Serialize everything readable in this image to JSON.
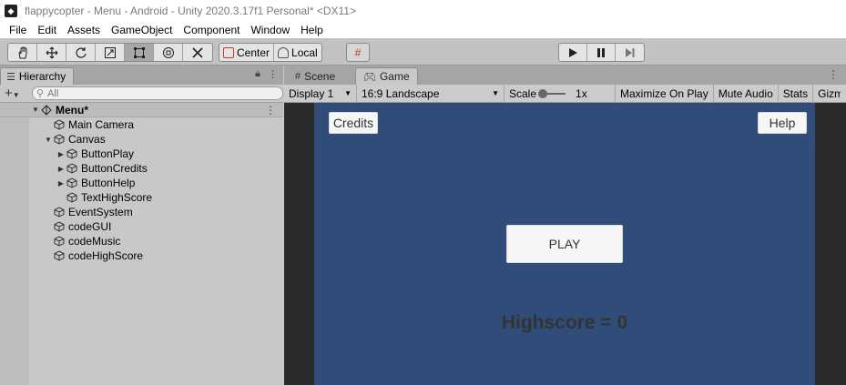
{
  "window": {
    "title": "flappycopter - Menu - Android - Unity 2020.3.17f1 Personal* <DX11>"
  },
  "menubar": [
    "File",
    "Edit",
    "Assets",
    "GameObject",
    "Component",
    "Window",
    "Help"
  ],
  "toolbar": {
    "tools": [
      "hand-tool",
      "move-tool",
      "rotate-tool",
      "scale-tool",
      "rect-tool",
      "transform-tool",
      "custom-tool"
    ],
    "active_tool": "rect-tool",
    "pivot_mode": "Center",
    "pivot_rotation": "Local"
  },
  "hierarchy": {
    "tab_label": "Hierarchy",
    "search_placeholder": "All",
    "scene_name": "Menu*",
    "items": [
      {
        "label": "Main Camera",
        "depth": 1,
        "arrow": ""
      },
      {
        "label": "Canvas",
        "depth": 1,
        "arrow": "expanded"
      },
      {
        "label": "ButtonPlay",
        "depth": 2,
        "arrow": "collapsed"
      },
      {
        "label": "ButtonCredits",
        "depth": 2,
        "arrow": "collapsed"
      },
      {
        "label": "ButtonHelp",
        "depth": 2,
        "arrow": "collapsed"
      },
      {
        "label": "TextHighScore",
        "depth": 2,
        "arrow": ""
      },
      {
        "label": "EventSystem",
        "depth": 1,
        "arrow": ""
      },
      {
        "label": "codeGUI",
        "depth": 1,
        "arrow": ""
      },
      {
        "label": "codeMusic",
        "depth": 1,
        "arrow": ""
      },
      {
        "label": "codeHighScore",
        "depth": 1,
        "arrow": ""
      }
    ]
  },
  "game_panel": {
    "tabs": {
      "scene": "Scene",
      "game": "Game"
    },
    "active_tab": "Game",
    "display": "Display 1",
    "aspect": "16:9 Landscape",
    "scale_label": "Scale",
    "scale_value": "1x",
    "maximize": "Maximize On Play",
    "mute": "Mute Audio",
    "stats": "Stats",
    "gizmos": "Gizmos"
  },
  "game_ui": {
    "credits_label": "Credits",
    "help_label": "Help",
    "play_label": "PLAY",
    "highscore_text": "Highscore = 0"
  },
  "colors": {
    "game_background": "#304c78",
    "button_face": "#f6f6f6"
  }
}
